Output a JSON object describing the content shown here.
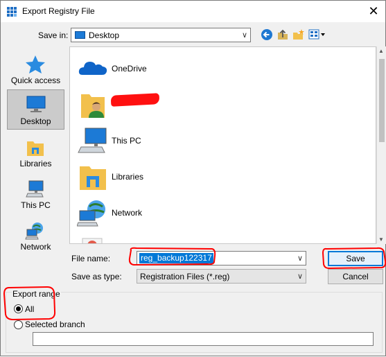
{
  "window": {
    "title": "Export Registry File",
    "close_glyph": "✕"
  },
  "toolbar": {
    "save_in_label": "Save in:",
    "save_in_value": "Desktop",
    "dropdown_glyph": "∨"
  },
  "places": [
    {
      "label": "Quick access",
      "icon": "star-icon"
    },
    {
      "label": "Desktop",
      "icon": "desktop-icon",
      "selected": true
    },
    {
      "label": "Libraries",
      "icon": "libraries-icon"
    },
    {
      "label": "This PC",
      "icon": "computer-icon"
    },
    {
      "label": "Network",
      "icon": "network-icon"
    }
  ],
  "files": [
    {
      "label": "OneDrive",
      "icon": "cloud-icon"
    },
    {
      "label": "",
      "icon": "user-folder-icon",
      "redacted": true
    },
    {
      "label": "This PC",
      "icon": "computer-icon"
    },
    {
      "label": "Libraries",
      "icon": "libraries-icon"
    },
    {
      "label": "Network",
      "icon": "network-icon"
    }
  ],
  "form": {
    "file_name_label": "File name:",
    "file_name_value": "reg_backup122317",
    "save_as_type_label": "Save as type:",
    "save_as_type_value": "Registration Files (*.reg)",
    "save_button": "Save",
    "cancel_button": "Cancel"
  },
  "export_range": {
    "title": "Export range",
    "all_label": "All",
    "selected_branch_label": "Selected branch",
    "selected_option": "All",
    "branch_value": ""
  },
  "colors": {
    "accent": "#0078d7",
    "annotation": "#ff0000",
    "redaction": "#ff1010"
  }
}
